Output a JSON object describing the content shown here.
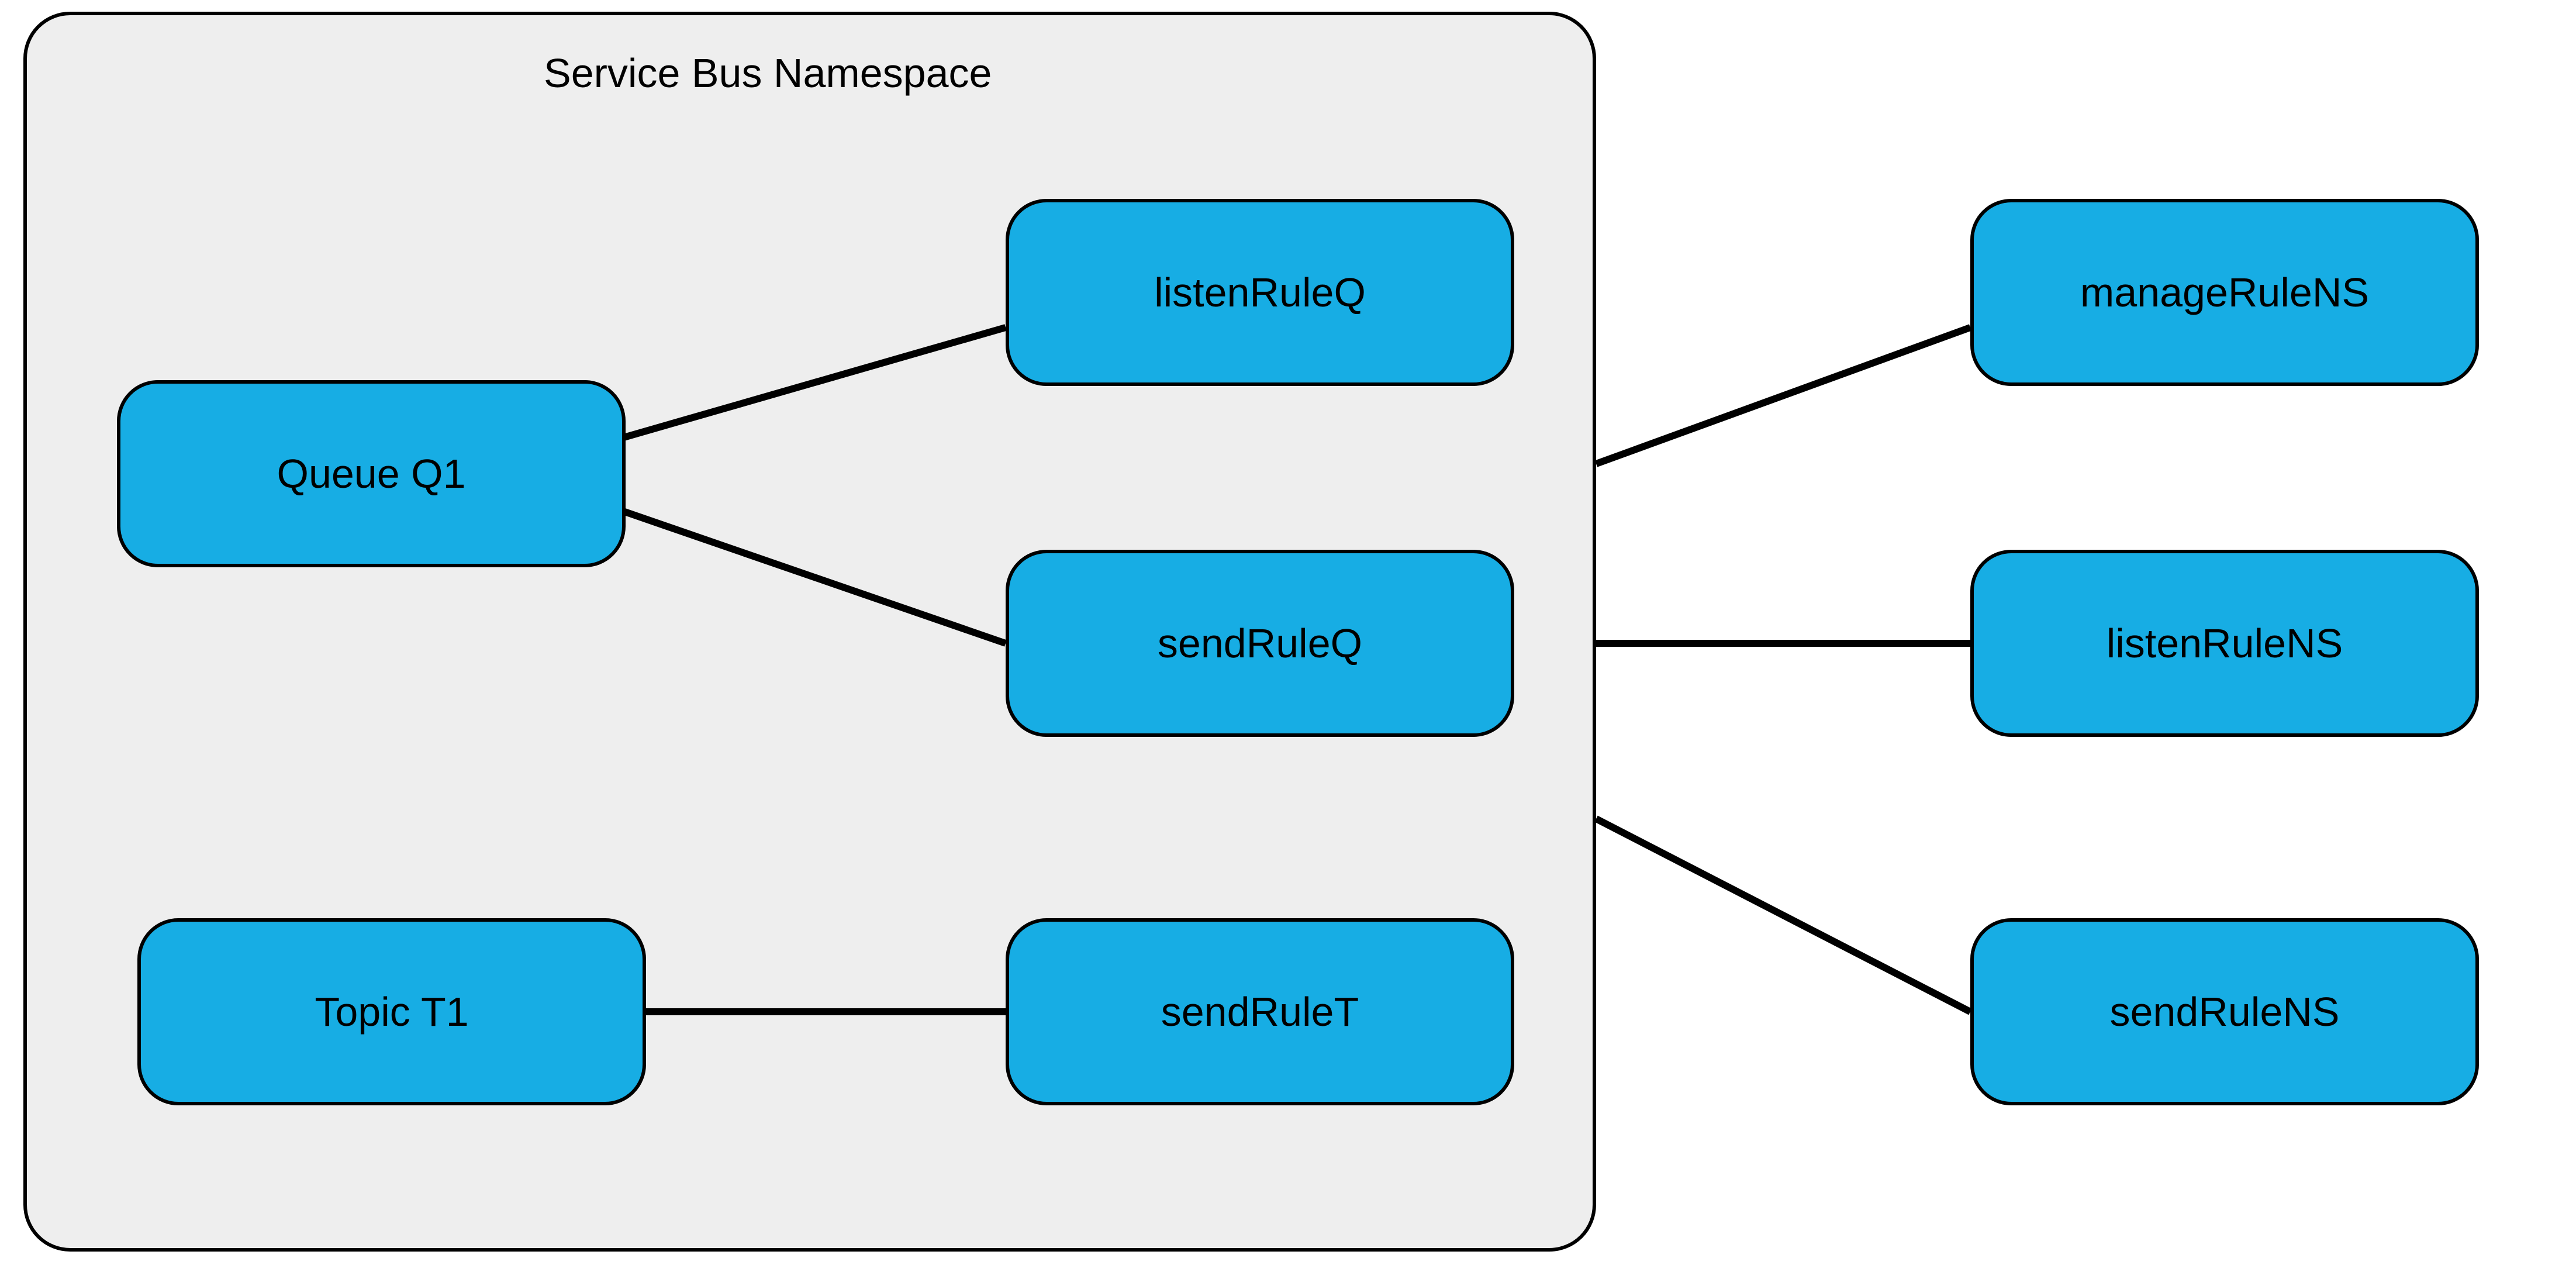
{
  "namespace": {
    "title": "Service Bus Namespace"
  },
  "nodes": {
    "queue": "Queue Q1",
    "topic": "Topic T1",
    "listenRuleQ": "listenRuleQ",
    "sendRuleQ": "sendRuleQ",
    "sendRuleT": "sendRuleT",
    "manageRuleNS": "manageRuleNS",
    "listenRuleNS": "listenRuleNS",
    "sendRuleNS": "sendRuleNS"
  }
}
